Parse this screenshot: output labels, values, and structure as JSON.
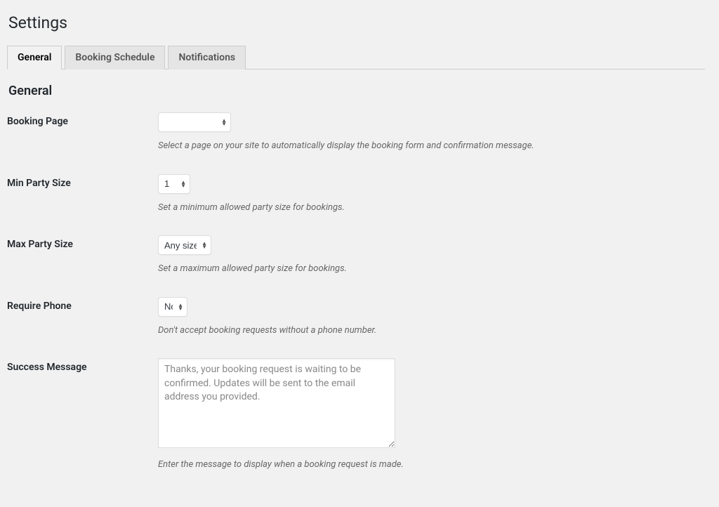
{
  "page": {
    "title": "Settings"
  },
  "tabs": {
    "general": "General",
    "schedule": "Booking Schedule",
    "notifications": "Notifications"
  },
  "section": {
    "title": "General"
  },
  "fields": {
    "booking_page": {
      "label": "Booking Page",
      "value": "",
      "description": "Select a page on your site to automatically display the booking form and confirmation message."
    },
    "min_party": {
      "label": "Min Party Size",
      "value": "1",
      "description": "Set a minimum allowed party size for bookings."
    },
    "max_party": {
      "label": "Max Party Size",
      "value": "Any size",
      "description": "Set a maximum allowed party size for bookings."
    },
    "require_phone": {
      "label": "Require Phone",
      "value": "No",
      "description": "Don't accept booking requests without a phone number."
    },
    "success_msg": {
      "label": "Success Message",
      "value": "Thanks, your booking request is waiting to be confirmed. Updates will be sent to the email address you provided.",
      "description": "Enter the message to display when a booking request is made."
    }
  }
}
